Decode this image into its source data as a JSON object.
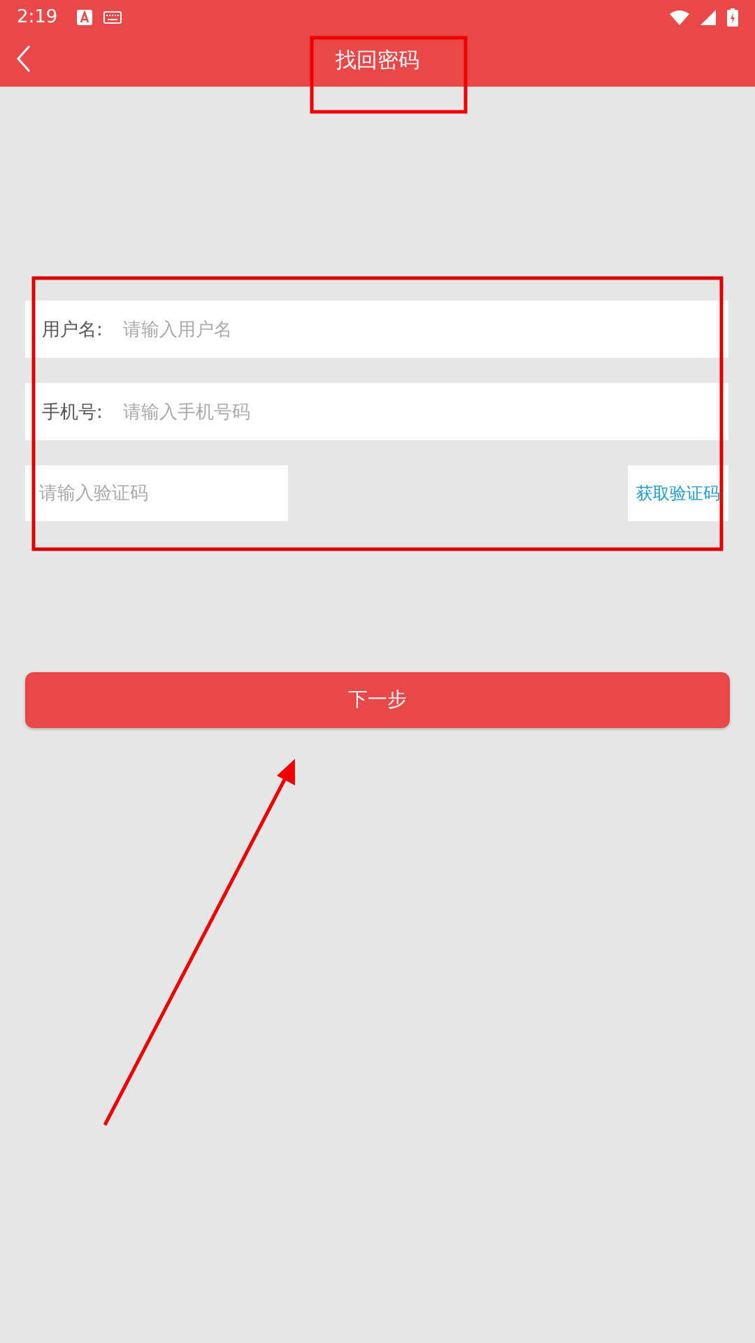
{
  "status_bar": {
    "time": "2:19"
  },
  "header": {
    "title": "找回密码"
  },
  "fields": [
    {
      "kind": "labeled",
      "label": "用户名:",
      "placeholder": "请输入用户名"
    },
    {
      "kind": "labeled",
      "label": "手机号:",
      "placeholder": "请输入手机号码"
    },
    {
      "kind": "code",
      "placeholder": "请输入验证码",
      "button": "获取验证码"
    }
  ],
  "submit": "下一步"
}
